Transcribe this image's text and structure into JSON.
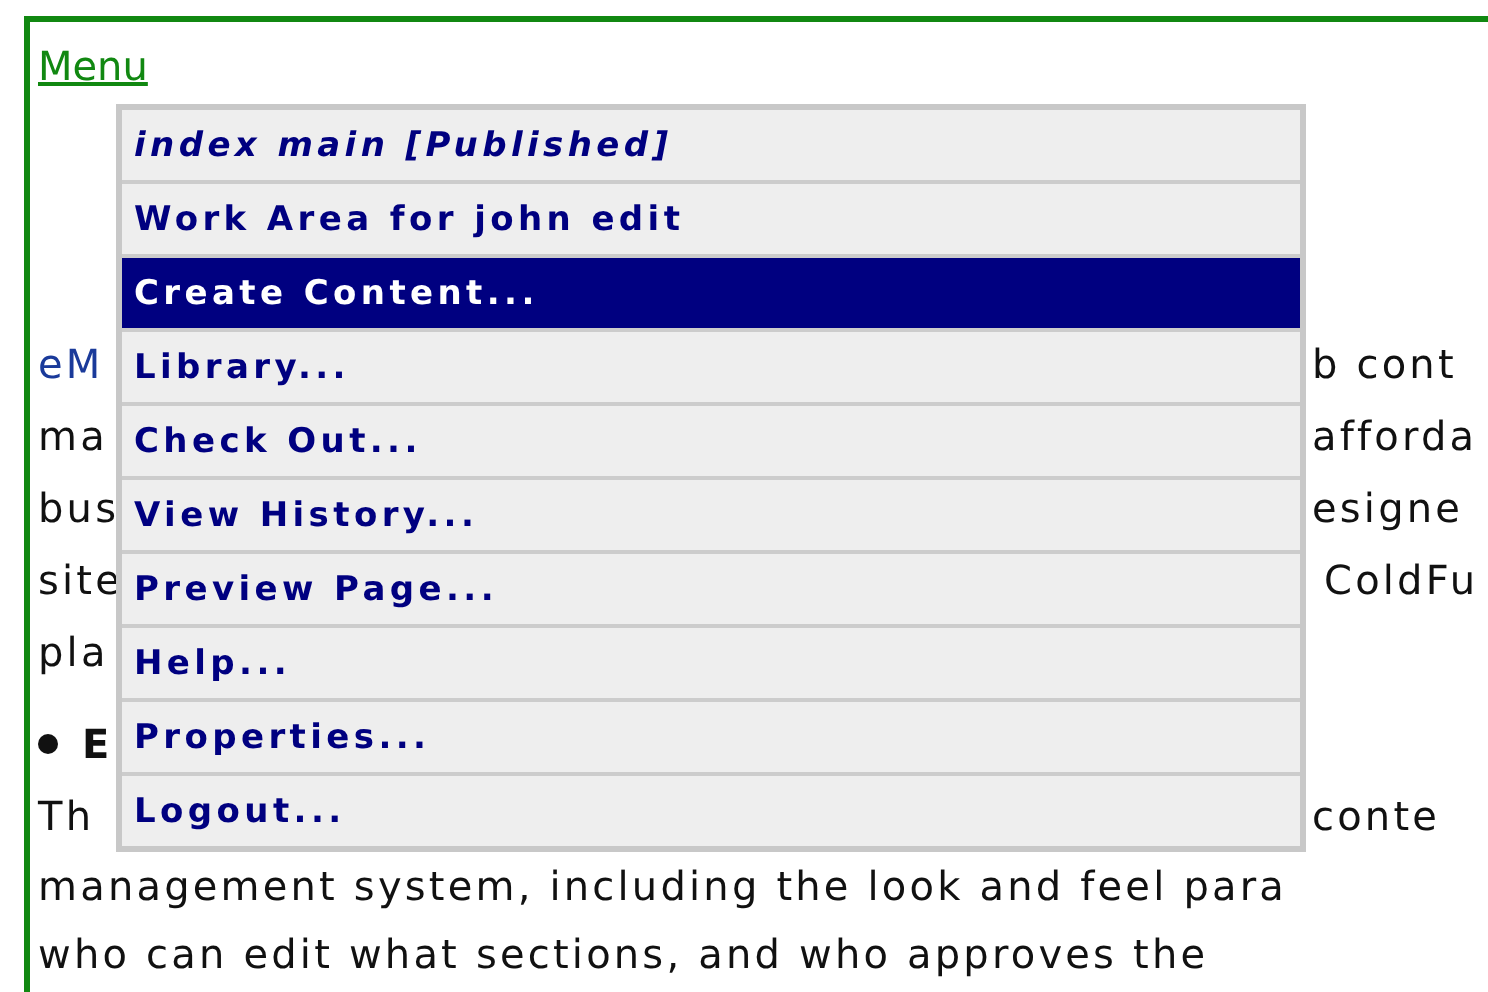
{
  "menu_link": "Menu",
  "popup_menu": {
    "items": [
      {
        "label": "index main [Published]",
        "kind": "title",
        "selected": false
      },
      {
        "label": "Work Area for john edit",
        "kind": "command",
        "selected": false
      },
      {
        "label": "Create Content...",
        "kind": "command",
        "selected": true
      },
      {
        "label": "Library...",
        "kind": "command",
        "selected": false
      },
      {
        "label": "Check Out...",
        "kind": "command",
        "selected": false
      },
      {
        "label": "View History...",
        "kind": "command",
        "selected": false
      },
      {
        "label": "Preview Page...",
        "kind": "command",
        "selected": false
      },
      {
        "label": "Help...",
        "kind": "command",
        "selected": false
      },
      {
        "label": "Properties...",
        "kind": "command",
        "selected": false
      },
      {
        "label": "Logout...",
        "kind": "command",
        "selected": false
      }
    ]
  },
  "page_text": {
    "lines": [
      {
        "kind": "link_split",
        "left": "eM",
        "right": "b cont"
      },
      {
        "kind": "split",
        "left": "ma",
        "right": "afforda"
      },
      {
        "kind": "split",
        "left": "bus",
        "right": "esigne"
      },
      {
        "kind": "split",
        "left": "site",
        "right": "ColdFu"
      },
      {
        "kind": "split",
        "left": "pla"
      },
      {
        "kind": "heading",
        "left": "E"
      },
      {
        "kind": "split",
        "left": "Th",
        "right": "conte"
      },
      {
        "kind": "full",
        "left": "management system, including the look and feel para"
      },
      {
        "kind": "full",
        "left": "who can edit what sections, and who approves the"
      }
    ]
  }
}
